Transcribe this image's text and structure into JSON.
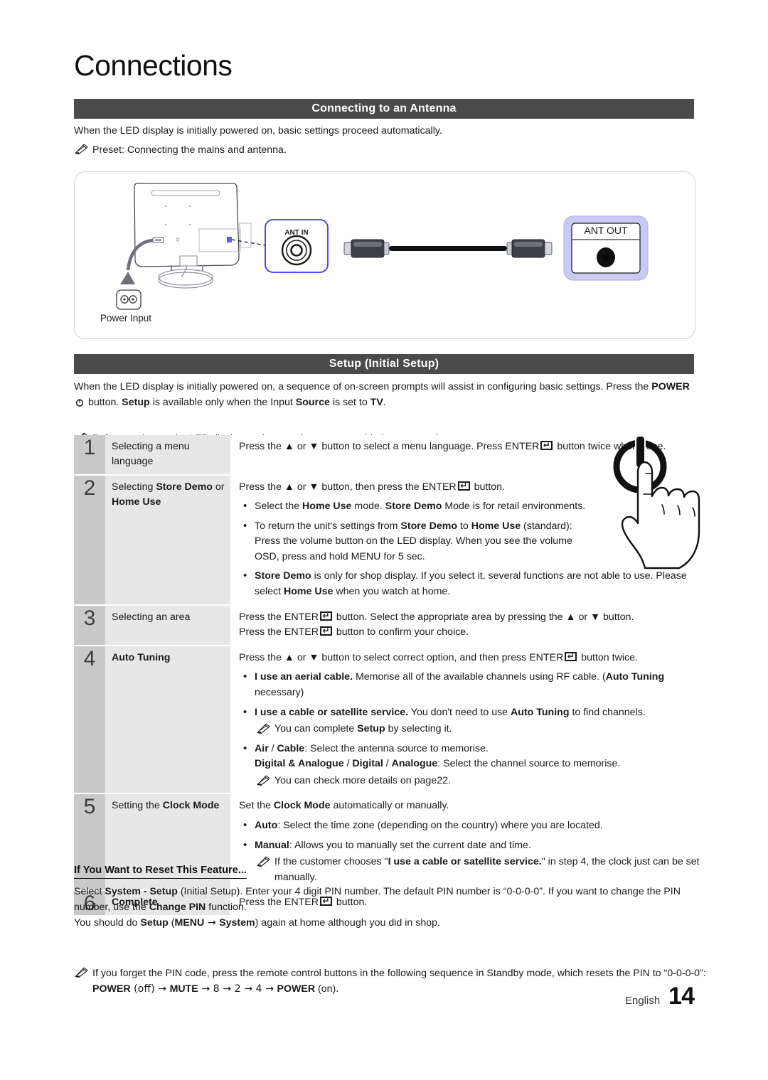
{
  "page": {
    "title": "Connections",
    "footer_language": "English",
    "footer_page_number": "14"
  },
  "sections": {
    "antenna": {
      "bar_title": "Connecting to an Antenna",
      "intro": "When the LED display is initially powered on, basic settings proceed automatically.",
      "note": "Preset: Connecting the mains and antenna.",
      "diagram": {
        "power_input_label": "Power Input",
        "ant_in_label": "ANT IN",
        "ant_out_label": "ANT OUT",
        "ant_in_border_color": "#3a3ae8",
        "ant_out_fill_color": "#c9c9f2"
      }
    },
    "setup": {
      "bar_title": "Setup (Initial Setup)",
      "intro_part1": "When the LED display is initially powered on, a sequence of on-screen prompts will assist in configuring basic settings. Press the ",
      "intro_power": "POWER",
      "intro_part2": " button. ",
      "intro_setup": "Setup",
      "intro_part3": " is available only when the Input ",
      "intro_source": "Source",
      "intro_part4": " is set to ",
      "intro_tv": "TV",
      "intro_part5": ".",
      "note": "Before turning on the LED display, make sure the antenna cable is connected."
    }
  },
  "steps": [
    {
      "number": "1",
      "label_plain": "Selecting a menu language",
      "desc_line1_a": "Press the ",
      "desc_line1_b": " or ",
      "desc_line1_c": " button to select a menu language. Press ENTER",
      "desc_line1_d": " button twice when done."
    },
    {
      "number": "2",
      "label_a": "Selecting ",
      "label_b": "Store Demo",
      "label_c": " or ",
      "label_d": "Home Use",
      "desc_intro_a": "Press the ",
      "desc_intro_b": " or ",
      "desc_intro_c": " button, then press the ENTER",
      "desc_intro_d": " button.",
      "b1_a": "Select the ",
      "b1_b": "Home Use",
      "b1_c": " mode. ",
      "b1_d": "Store Demo",
      "b1_e": " Mode is for retail environments.",
      "b2_a": "To return the unit's settings from ",
      "b2_b": "Store Demo",
      "b2_c": " to ",
      "b2_d": "Home Use",
      "b2_e": " (standard):",
      "b2_l2": "Press the volume button on the LED display. When you see the volume",
      "b2_l3_a": "OSD, press and hold ",
      "b2_l3_b": "MENU",
      "b2_l3_c": " for 5 sec.",
      "b3_a": "Store Demo",
      "b3_b": " is only for shop display. If you select it, several functions are not able to use. Please select ",
      "b3_c": "Home Use",
      "b3_d": " when you watch at home."
    },
    {
      "number": "3",
      "label_plain": "Selecting an area",
      "desc_l1_a": "Press the ENTER",
      "desc_l1_b": " button. Select the appropriate area by pressing the ",
      "desc_l1_c": " or ",
      "desc_l1_d": " button.",
      "desc_l2_a": "Press the ENTER",
      "desc_l2_b": " button to confirm your choice."
    },
    {
      "number": "4",
      "label_bold": "Auto Tuning",
      "desc_intro_a": "Press the ",
      "desc_intro_b": " or ",
      "desc_intro_c": " button to select correct option, and then press ENTER",
      "desc_intro_d": " button twice.",
      "b1_a": "I use an aerial cable.",
      "b1_b": " Memorise all of the available channels using RF cable. (",
      "b1_c": "Auto Tuning",
      "b1_d": " necessary)",
      "b2_a": "I use a cable or satellite service.",
      "b2_b": " You don't need to use ",
      "b2_c": "Auto Tuning",
      "b2_d": " to find channels.",
      "b2_note_a": "You can complete ",
      "b2_note_b": "Setup",
      "b2_note_c": " by selecting it.",
      "b3_a": "Air",
      "b3_b": " / ",
      "b3_c": "Cable",
      "b3_d": ": Select the antenna source to memorise.",
      "b3_l2_a": "Digital & Analogue",
      "b3_l2_b": " / ",
      "b3_l2_c": "Digital",
      "b3_l2_d": " / ",
      "b3_l2_e": "Analogue",
      "b3_l2_f": ": Select the channel source to memorise.",
      "b3_note": "You can check more details on page22."
    },
    {
      "number": "5",
      "label_a": "Setting the ",
      "label_b": "Clock Mode",
      "desc_intro_a": "Set the ",
      "desc_intro_b": "Clock Mode",
      "desc_intro_c": " automatically or manually.",
      "b1_a": "Auto",
      "b1_b": ": Select the time zone (depending on the country) where you are located.",
      "b2_a": "Manual",
      "b2_b": ": Allows you to manually set the current date and time.",
      "b2_note_a": "If the customer chooses \"",
      "b2_note_b": "I use a cable or satellite service.",
      "b2_note_c": "\" in step 4, the clock just can be set manually."
    },
    {
      "number": "6",
      "label_bold": "Complete",
      "desc_a": "Press the ENTER",
      "desc_b": " button."
    }
  ],
  "reset": {
    "heading": "If You Want to Reset This Feature...",
    "p1_a": "Select ",
    "p1_b": "System - Setup",
    "p1_c": " (Initial Setup). Enter your 4 digit PIN number. The default PIN number is “0-0-0-0”. If you want to change the PIN number, use the ",
    "p1_d": "Change PIN",
    "p1_e": " function.",
    "p2_a": "You should do ",
    "p2_b": "Setup",
    "p2_c": " (",
    "p2_d": "MENU",
    "p2_e": " → ",
    "p2_f": "System",
    "p2_g": ") again at home although you did in shop.",
    "note_a": "If you forget the PIN code, press the remote control buttons in the following sequence in Standby mode, which resets the PIN to “0-0-0-0”: ",
    "note_power_off": "POWER",
    "note_off": " (off) → ",
    "note_mute": "MUTE",
    "note_seq": " → 8 → 2 → 4 → ",
    "note_power_on": "POWER",
    "note_on": " (on)."
  },
  "colors": {
    "bar_bg": "#4a4a4a",
    "step_num_bg": "#c9c9c9",
    "step_label_bg": "#e7e7e7",
    "text": "#1a1a1a"
  }
}
